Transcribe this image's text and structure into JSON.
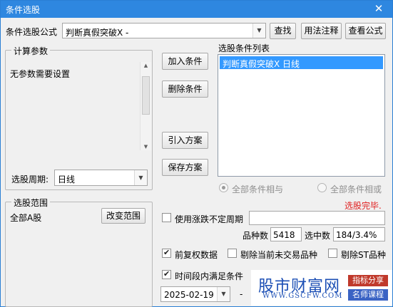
{
  "window": {
    "title": "条件选股",
    "close_glyph": "✕"
  },
  "formula": {
    "label": "条件选股公式",
    "value": "判断真假突破X  -",
    "buttons": {
      "find": "查找",
      "usage": "用法注释",
      "view": "查看公式"
    }
  },
  "params": {
    "group_title": "计算参数",
    "message": "无参数需要设置"
  },
  "period": {
    "label": "选股周期:",
    "value": "日线"
  },
  "range": {
    "group_title": "选股范围",
    "value": "全部A股",
    "change_button": "改变范围"
  },
  "actions": {
    "add": "加入条件",
    "delete": "删除条件",
    "import": "引入方案",
    "save": "保存方案"
  },
  "condition_list": {
    "title": "选股条件列表",
    "items": [
      "判断真假突破X  日线"
    ]
  },
  "logic": {
    "and_label": "全部条件相与",
    "or_label": "全部条件相或",
    "selected": "and"
  },
  "status": {
    "text": "选股完毕.",
    "color": "#e02020"
  },
  "unfixed_period": {
    "label": "使用涨跌不定周期",
    "checked": false,
    "value": ""
  },
  "stats": {
    "count_label": "品种数",
    "count_value": "5418",
    "hit_label": "选中数",
    "hit_value": "184/3.4%"
  },
  "options": {
    "pre_adjust": {
      "label": "前复权数据",
      "checked": true
    },
    "exclude_untraded": {
      "label": "剔除当前未交易品种",
      "checked": false
    },
    "exclude_st": {
      "label": "剔除ST品种",
      "checked": false
    },
    "period_satisfy": {
      "label": "时间段内满足条件",
      "checked": true
    }
  },
  "date": {
    "start": "2025-02-19",
    "separator": "-"
  },
  "watermark": {
    "logo": "股市财富网",
    "url": "WWW.GSCFW.COM",
    "tag1": "指标分享",
    "tag2": "名师课程",
    "tag1_color": "#c0392b",
    "tag2_color": "#3a63c4"
  },
  "icons": {
    "combo_arrow": "chevron-down-icon",
    "scroll_up": "scroll-up-icon",
    "scroll_down": "scroll-down-icon"
  }
}
